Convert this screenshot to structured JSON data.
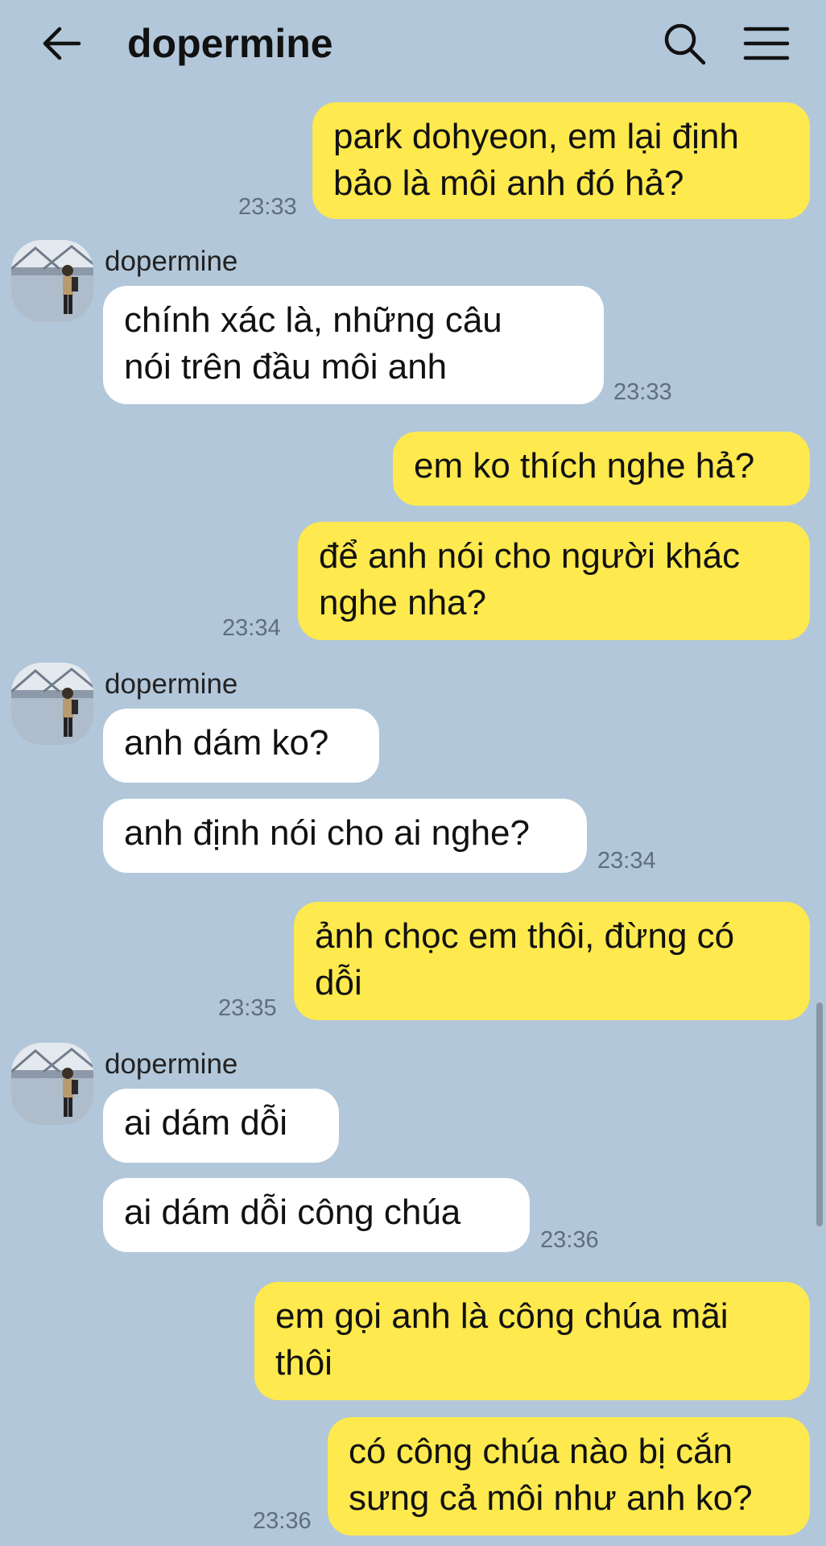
{
  "header": {
    "title": "dopermine",
    "back_icon": "arrow-left-icon",
    "search_icon": "search-icon",
    "menu_icon": "hamburger-menu-icon"
  },
  "colors": {
    "background": "#b2c7d9",
    "my_bubble": "#fee94e",
    "their_bubble": "#ffffff"
  },
  "messages": [
    {
      "from": "me",
      "lines": [
        "park dohyeon, em lại định",
        "bảo là môi anh đó hả?"
      ],
      "time": "23:33"
    },
    {
      "sender": "dopermine",
      "from": "them",
      "lines": [
        "chính xác là, những câu",
        "nói trên đầu môi anh"
      ],
      "time": "23:33"
    },
    {
      "from": "me",
      "lines": [
        "em ko thích nghe hả?"
      ]
    },
    {
      "from": "me",
      "lines": [
        "để anh nói cho người khác",
        "nghe nha?"
      ],
      "time": "23:34"
    },
    {
      "sender": "dopermine",
      "from": "them",
      "lines": [
        "anh dám ko?"
      ]
    },
    {
      "from": "them",
      "lines": [
        "anh định nói cho ai nghe?"
      ],
      "time": "23:34"
    },
    {
      "from": "me",
      "lines": [
        "ảnh chọc em thôi, đừng có",
        "dỗi"
      ],
      "time": "23:35"
    },
    {
      "sender": "dopermine",
      "from": "them",
      "lines": [
        "ai dám dỗi"
      ]
    },
    {
      "from": "them",
      "lines": [
        "ai dám dỗi công chúa"
      ],
      "time": "23:36"
    },
    {
      "from": "me",
      "lines": [
        "em gọi anh là công chúa mãi",
        "thôi"
      ]
    },
    {
      "from": "me",
      "lines": [
        "có công chúa nào bị cắn",
        "sưng cả môi như anh ko?"
      ],
      "time": "23:36"
    }
  ]
}
